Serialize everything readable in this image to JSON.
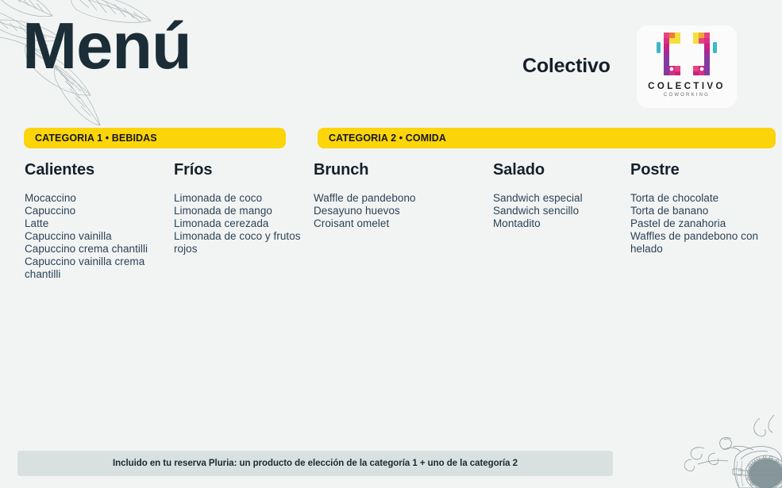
{
  "header": {
    "title": "Menú",
    "brand_name": "Colectivo",
    "logo": {
      "wordmark": "COLECTIVO",
      "subword": "COWORKING"
    }
  },
  "categories": [
    {
      "banner_label": "CATEGORIA 1 • BEBIDAS"
    },
    {
      "banner_label": "CATEGORIA 2 • COMIDA"
    }
  ],
  "columns": [
    {
      "title": "Calientes",
      "items": [
        "Mocaccino",
        "Capuccino",
        "Latte",
        "Capuccino vainilla",
        "Capuccino crema chantilli",
        "Capuccino vainilla crema chantilli"
      ]
    },
    {
      "title": "Fríos",
      "items": [
        "Limonada de coco",
        "Limonada de mango",
        "Limonada cerezada",
        "Limonada de coco y frutos rojos"
      ]
    },
    {
      "title": "Brunch",
      "items": [
        "Waffle de pandebono",
        "Desayuno huevos",
        "Croisant omelet"
      ]
    },
    {
      "title": "Salado",
      "items": [
        "Sandwich especial",
        "Sandwich sencillo",
        "Montadito"
      ]
    },
    {
      "title": "Postre",
      "items": [
        "Torta de chocolate",
        "Torta de banano",
        "Pastel de zanahoria",
        "Waffles de pandebono con helado"
      ]
    }
  ],
  "footer": {
    "note": "Incluido en tu reserva Pluria: un producto de elección de la categoría 1 + uno de la categoría 2"
  },
  "colors": {
    "background": "#f2f4f3",
    "banner_yellow": "#fbd509",
    "title_navy": "#1b2d37",
    "item_text": "#2c4257",
    "footer_bar": "#d8e0e0",
    "logo_magenta": "#c9227f",
    "logo_purple": "#7b3f9d",
    "logo_yellow": "#f3e03a",
    "logo_pink": "#e8437e",
    "logo_teal": "#3fb8c8"
  }
}
